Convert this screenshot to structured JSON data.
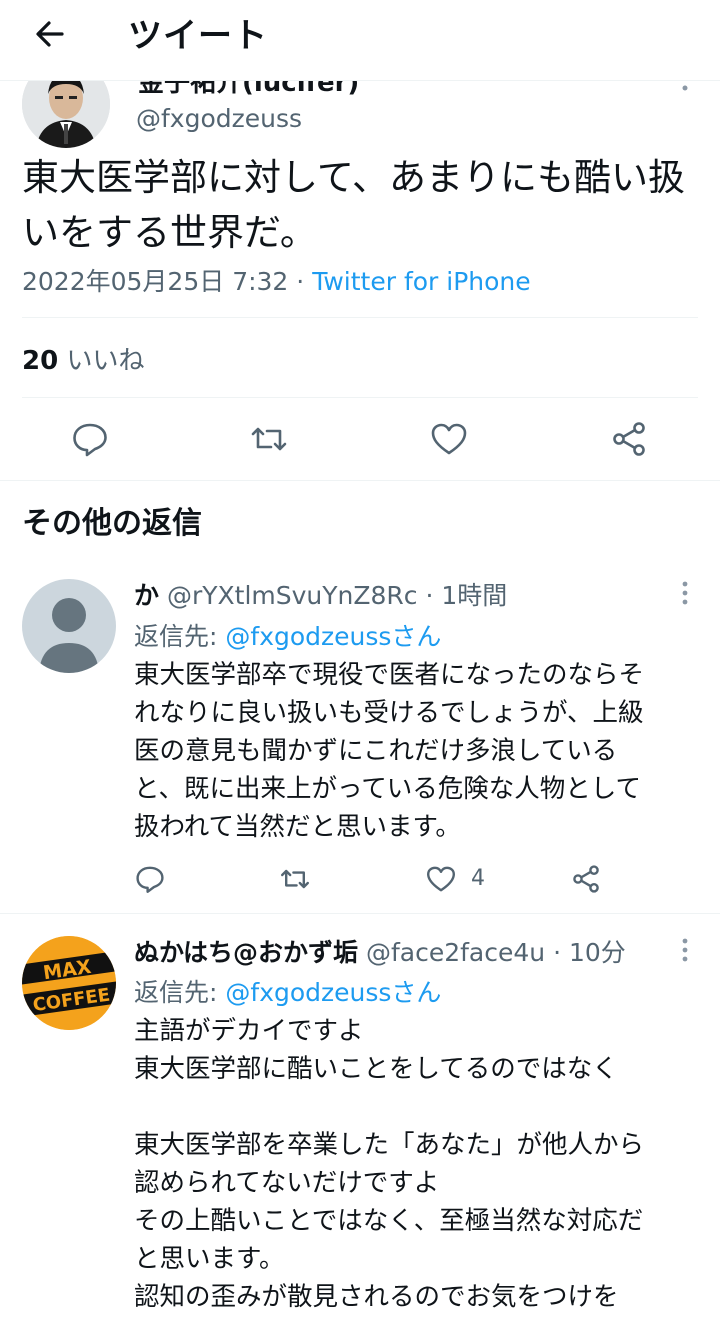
{
  "header": {
    "title": "ツイート"
  },
  "tweet": {
    "name": "金子祐介(lucifer)",
    "handle": "@fxgodzeuss",
    "text": "東大医学部に対して、あまりにも酷い扱いをする世界だ。",
    "datetime": "2022年05月25日 7:32",
    "separator": "·",
    "source": "Twitter for iPhone",
    "likes_count": "20",
    "likes_label": "いいね"
  },
  "section_title": "その他の返信",
  "replies": [
    {
      "name": "か",
      "handle": "@rYXtlmSvuYnZ8Rc",
      "time": "1時間",
      "reply_to_label": "返信先:",
      "reply_to": "@fxgodzeussさん",
      "text": "東大医学部卒で現役で医者になったのならそ\nれなりに良い扱いも受けるでしょうが、上級\n医の意見も聞かずにこれだけ多浪している\nと、既に出来上がっている危険な人物として\n扱われて当然だと思います。",
      "like_count": "4"
    },
    {
      "name": "ぬかはち@おかず垢",
      "handle": "@face2face4u",
      "time": "10分",
      "reply_to_label": "返信先:",
      "reply_to": "@fxgodzeussさん",
      "text": "主語がデカイですよ\n東大医学部に酷いことをしてるのではなく\n\n東大医学部を卒業した「あなた」が他人から\n認められてないだけですよ\nその上酷いことではなく、至極当然な対応だ\nと思います。\n認知の歪みが散見されるのでお気をつけを",
      "avatar_text": "MAX COFFEE"
    }
  ],
  "colors": {
    "accent": "#1d9bf0",
    "muted": "#536471",
    "text": "#0f1419",
    "divider": "#eff3f4"
  },
  "icons": [
    "back-arrow-icon",
    "more-icon",
    "reply-icon",
    "retweet-icon",
    "like-icon",
    "share-icon",
    "default-avatar-icon"
  ]
}
